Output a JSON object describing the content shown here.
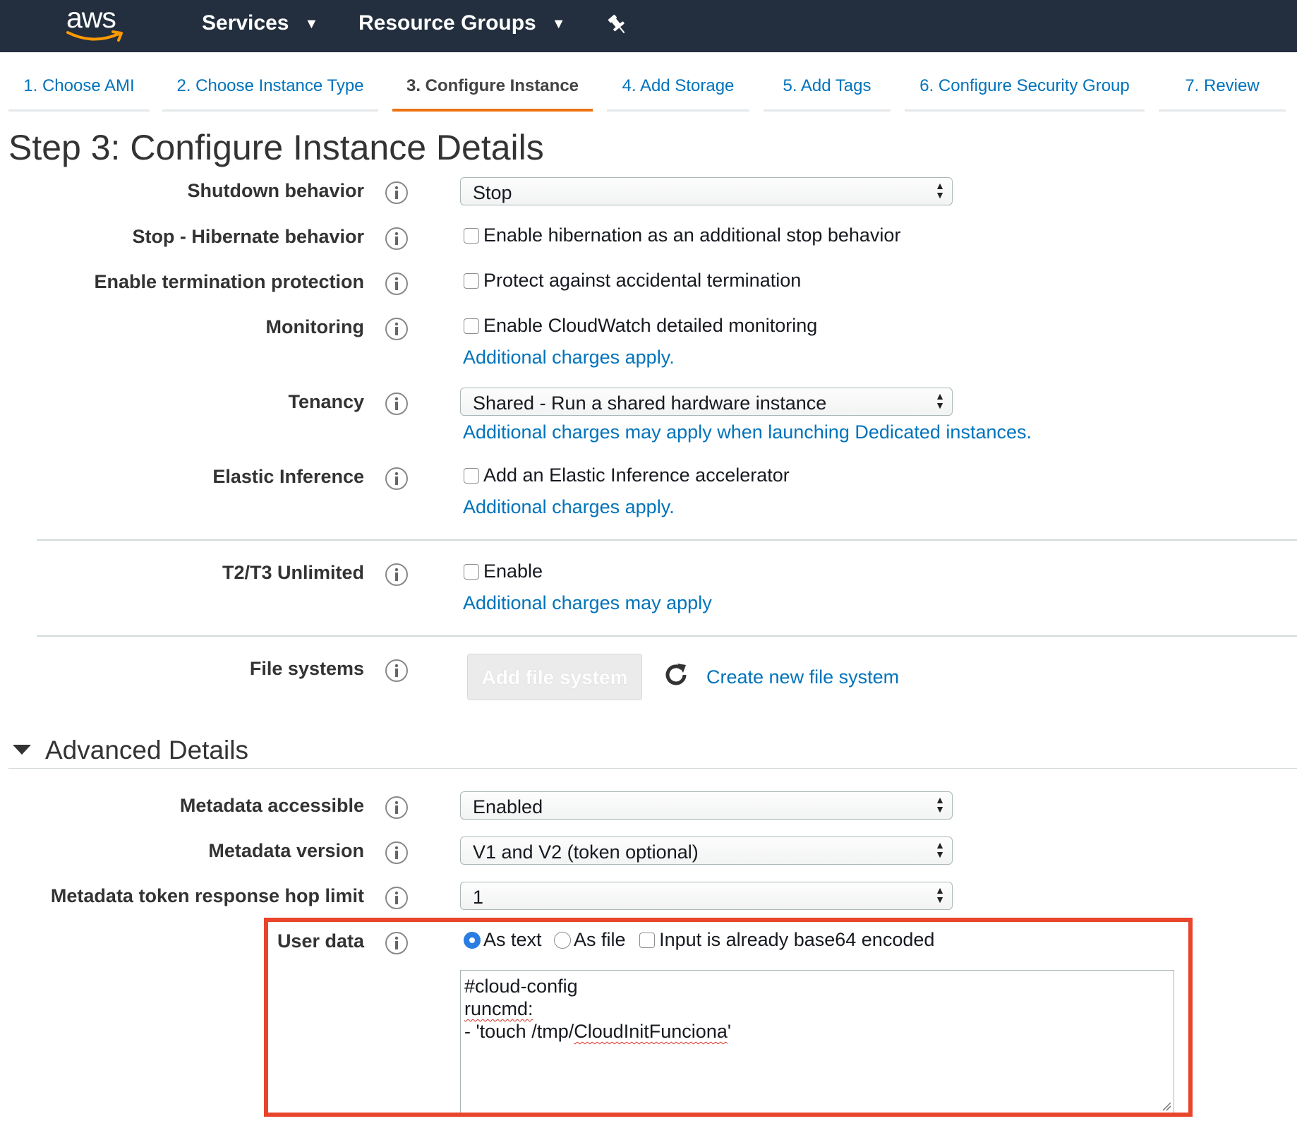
{
  "topbar": {
    "logo": "aws",
    "services_label": "Services",
    "resource_groups_label": "Resource Groups",
    "pin_icon": "pin-icon"
  },
  "wizard": {
    "tabs": [
      {
        "label": "1. Choose AMI",
        "active": false
      },
      {
        "label": "2. Choose Instance Type",
        "active": false
      },
      {
        "label": "3. Configure Instance",
        "active": true
      },
      {
        "label": "4. Add Storage",
        "active": false
      },
      {
        "label": "5. Add Tags",
        "active": false
      },
      {
        "label": "6. Configure Security Group",
        "active": false
      },
      {
        "label": "7. Review",
        "active": false
      }
    ]
  },
  "page_title": "Step 3: Configure Instance Details",
  "fields": {
    "shutdown": {
      "label": "Shutdown behavior",
      "value": "Stop"
    },
    "hibernate": {
      "label": "Stop - Hibernate behavior",
      "checkbox": "Enable hibernation as an additional stop behavior",
      "checked": false
    },
    "termination": {
      "label": "Enable termination protection",
      "checkbox": "Protect against accidental termination",
      "checked": false
    },
    "monitoring": {
      "label": "Monitoring",
      "checkbox": "Enable CloudWatch detailed monitoring",
      "checked": false,
      "link": "Additional charges apply."
    },
    "tenancy": {
      "label": "Tenancy",
      "value": "Shared - Run a shared hardware instance",
      "link": "Additional charges may apply when launching Dedicated instances."
    },
    "elastic": {
      "label": "Elastic Inference",
      "checkbox": "Add an Elastic Inference accelerator",
      "checked": false,
      "link": "Additional charges apply."
    },
    "unlimited": {
      "label": "T2/T3 Unlimited",
      "checkbox": "Enable",
      "checked": false,
      "link": "Additional charges may apply"
    },
    "filesystems": {
      "label": "File systems",
      "button": "Add file system",
      "link": "Create new file system"
    }
  },
  "advanced": {
    "title": "Advanced Details",
    "metadata_accessible": {
      "label": "Metadata accessible",
      "value": "Enabled"
    },
    "metadata_version": {
      "label": "Metadata version",
      "value": "V1 and V2 (token optional)"
    },
    "hop_limit": {
      "label": "Metadata token response hop limit",
      "value": "1"
    },
    "user_data": {
      "label": "User data",
      "as_text": "As text",
      "as_file": "As file",
      "base64": "Input is already base64 encoded",
      "selected": "As text",
      "base64_checked": false,
      "line1": "#cloud-config",
      "line2": "runcmd:",
      "line3_prefix": "- 'touch /tmp/",
      "line3_word": "CloudInitFunciona",
      "line3_suffix": "'"
    }
  },
  "colors": {
    "topbar": "#232f3e",
    "link": "#0073bb",
    "active_tab": "#ec7211",
    "highlight_box": "#e8452c"
  }
}
